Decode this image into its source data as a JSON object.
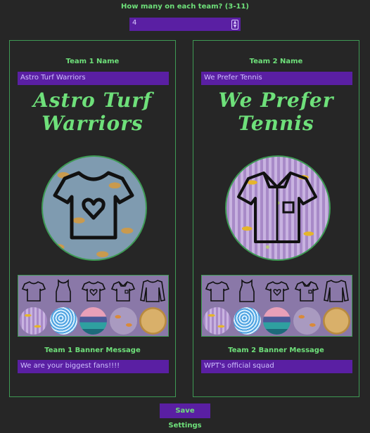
{
  "team_size": {
    "label": "How many on each team? (3-11)",
    "value": "4"
  },
  "teams": [
    {
      "name_label": "Team 1 Name",
      "name_value": "Astro Turf Warriors",
      "title_line1": "Astro Turf",
      "title_line2": "Warriors",
      "jersey_style": "heart-tee-icon",
      "jersey_pattern": "ducks",
      "banner_label": "Team 1 Banner Message",
      "banner_value": "We are your biggest fans!!!!"
    },
    {
      "name_label": "Team 2 Name",
      "name_value": "We Prefer Tennis",
      "title_line1": "We Prefer",
      "title_line2": "Tennis",
      "jersey_style": "polo-shirt-icon",
      "jersey_pattern": "bananas",
      "banner_label": "Team 2 Banner Message",
      "banner_value": "WPT's official squad"
    }
  ],
  "styles": [
    "tshirt-icon",
    "tank-top-icon",
    "heart-tee-icon",
    "polo-shirt-icon",
    "long-sleeve-icon"
  ],
  "patterns": [
    "bananas",
    "waves",
    "sunset",
    "burgers",
    "biscuit"
  ],
  "save_label": "Save Settings",
  "colors": {
    "accent": "#6ee07a",
    "field": "#5a1fa3",
    "background": "#262626"
  }
}
